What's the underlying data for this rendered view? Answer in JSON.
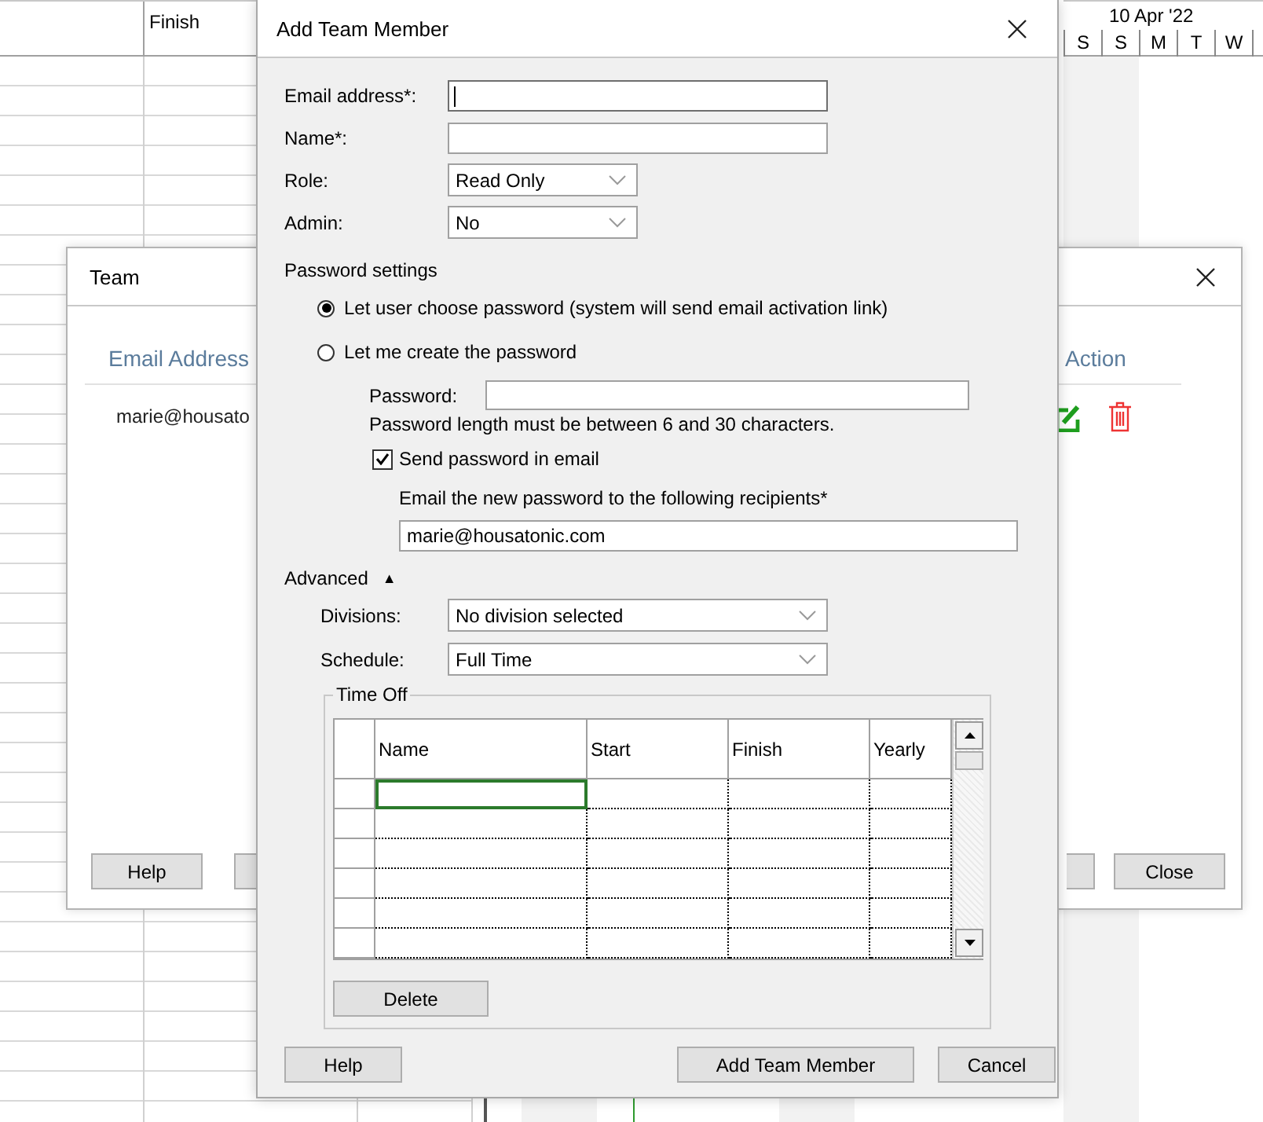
{
  "sheet": {
    "column_headers": [
      "Finish"
    ]
  },
  "timeline": {
    "week": "10 Apr '22",
    "days": [
      "S",
      "S",
      "M",
      "T",
      "W"
    ]
  },
  "team_window": {
    "title": "Team",
    "columns": [
      "Email Address",
      "Action"
    ],
    "rows": [
      {
        "email": "marie@housato"
      }
    ],
    "buttons": [
      "Help",
      "Close"
    ]
  },
  "dialog": {
    "title": "Add Team Member",
    "fields": [
      {
        "kind": "text",
        "label": "Email address*:",
        "focused": true
      },
      {
        "kind": "text",
        "label": "Name*:",
        "focused": false
      },
      {
        "kind": "select",
        "label": "Role:",
        "value": "Read Only"
      },
      {
        "kind": "select",
        "label": "Admin:",
        "value": "No"
      }
    ],
    "password_settings": {
      "heading": "Password settings",
      "options": [
        {
          "label": "Let user choose password (system will send email activation link)",
          "selected": true
        },
        {
          "label": "Let me create the password",
          "selected": false
        }
      ],
      "password_label": "Password:",
      "hint": "Password length must be between 6 and 30 characters.",
      "send_email": {
        "label": "Send password in email",
        "checked": true
      },
      "recipients_label": "Email the new password to the following recipients*",
      "recipients": "marie@housatonic.com"
    },
    "advanced": {
      "label": "Advanced",
      "toggle": "▲",
      "fields": [
        {
          "label": "Divisions:",
          "value": "No division selected"
        },
        {
          "label": "Schedule:",
          "value": "Full Time"
        }
      ]
    },
    "time_off": {
      "title": "Time Off",
      "columns": [
        "Name",
        "Start",
        "Finish",
        "Yearly"
      ],
      "rows": [
        {
          "selected": true
        },
        {
          "selected": false
        },
        {
          "selected": false
        },
        {
          "selected": false
        },
        {
          "selected": false
        },
        {
          "selected": false
        }
      ],
      "buttons": [
        "Delete"
      ]
    },
    "buttons": [
      "Help",
      "Add Team Member",
      "Cancel"
    ]
  }
}
